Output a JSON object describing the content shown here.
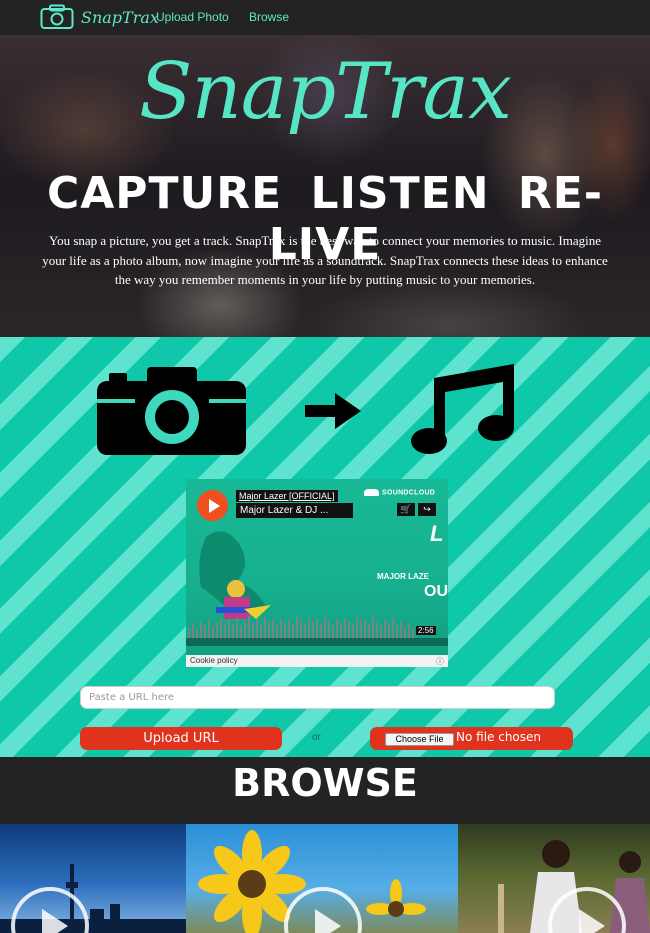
{
  "nav": {
    "brand": "SnapTrax",
    "upload_link": "Upload Photo",
    "browse_link": "Browse"
  },
  "hero": {
    "logo": "SnapTrax",
    "headline": "CAPTURE  LISTEN  RE-LIVE",
    "description": "You snap a picture, you get a track. SnapTrax is the best way to connect your memories to music. Imagine your life as a photo album, now imagine your life as a soundtrack. SnapTrax connects these ideas to enhance the way you remember moments in your life by putting music to your memories."
  },
  "icons": {
    "camera": "camera-icon",
    "arrow": "arrow-right-icon",
    "music": "music-note-icon"
  },
  "player": {
    "user": "Major Lazer [OFFICIAL]",
    "track": "Major Lazer & DJ ...",
    "brand": "SOUNDCLOUD",
    "art_letter": "L",
    "art_artist": "MAJOR LAZE",
    "art_out": "OU",
    "time": "2:56",
    "cookie": "Cookie policy"
  },
  "form": {
    "url_placeholder": "Paste a URL here",
    "upload_label": "Upload URL",
    "or_label": "or",
    "choose_file_label": "Choose File",
    "file_status": "No file chosen"
  },
  "browse": {
    "title": "BROWSE"
  },
  "colors": {
    "accent": "#5de8c9",
    "teal_light": "#5ee3ce",
    "teal_dark": "#0fc8a9",
    "button_red": "#e0331e",
    "nav_bg": "#232323"
  }
}
